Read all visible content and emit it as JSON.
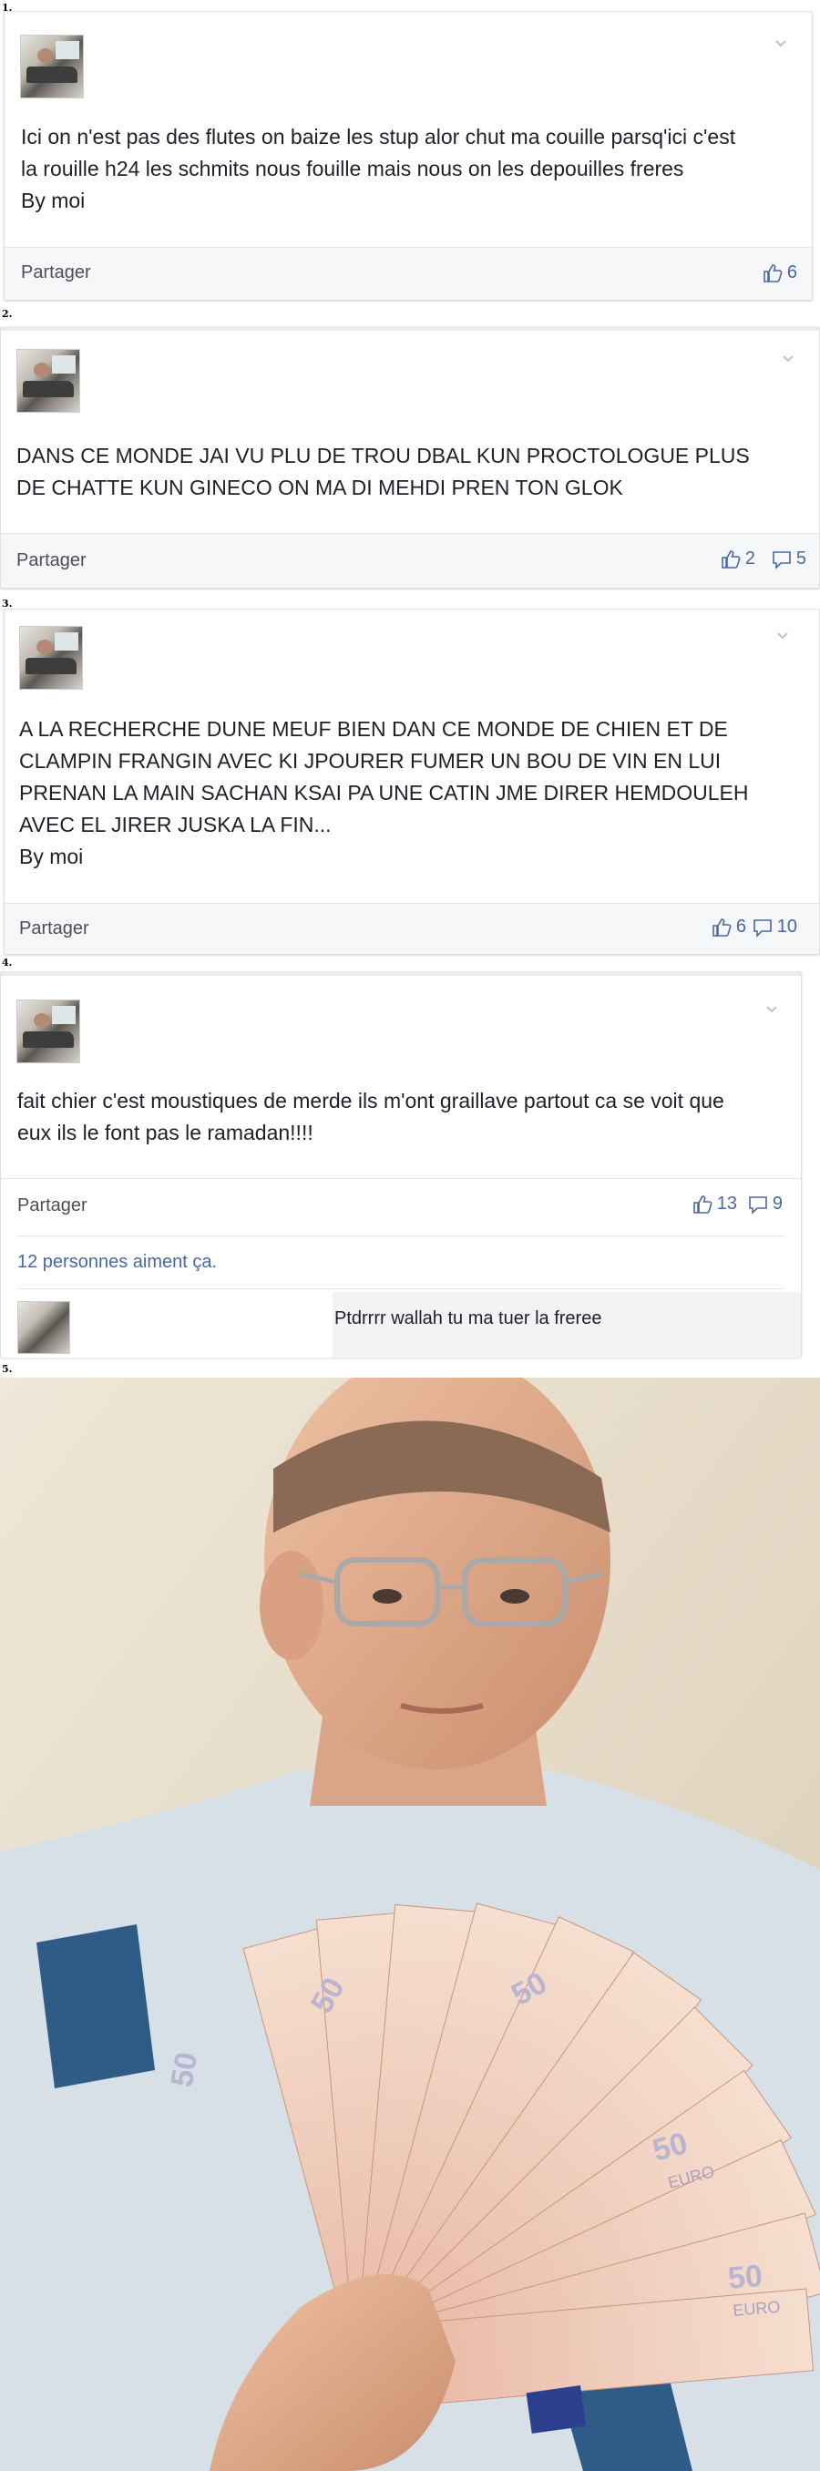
{
  "posts": [
    {
      "number": "1.",
      "text_lines": [
        "Ici on n'est pas des flutes on baize les stup alor chut ma couille parsq'ici c'est",
        "la rouille h24 les schmits nous fouille mais nous on les depouilles freres",
        "By moi"
      ],
      "share_label": "Partager",
      "likes": "6"
    },
    {
      "number": "2.",
      "text_lines": [
        "DANS CE MONDE JAI VU PLU DE TROU DBAL KUN PROCTOLOGUE PLUS",
        "DE CHATTE KUN GINECO ON MA DI MEHDI PREN TON GLOK"
      ],
      "share_label": "Partager",
      "likes": "2",
      "comments": "5"
    },
    {
      "number": "3.",
      "text_lines": [
        "A LA RECHERCHE DUNE MEUF BIEN DAN CE MONDE DE CHIEN ET DE",
        "CLAMPIN FRANGIN AVEC KI JPOURER FUMER UN BOU DE VIN EN LUI",
        "PRENAN LA MAIN SACHAN KSAI PA UNE CATIN JME DIRER HEMDOULEH",
        "AVEC EL JIRER JUSKA LA FIN...",
        "By moi"
      ],
      "share_label": "Partager",
      "likes": "6",
      "comments": "10"
    },
    {
      "number": "4.",
      "text_lines": [
        "fait chier c'est moustiques de merde ils m'ont graillave partout ca se voit que",
        "eux ils le font pas le ramadan!!!!"
      ],
      "share_label": "Partager",
      "likes": "13",
      "comments": "9",
      "likes_summary_count": "12 personnes",
      "likes_summary_suffix": " aiment ça.",
      "comment_text": "Ptdrrrr wallah tu ma tuer la freree"
    }
  ],
  "photo": {
    "number": "5.",
    "banknote_value": "50",
    "banknote_word": "EURO"
  },
  "colors": {
    "link_blue": "#4b67a1",
    "footer_bg": "#f6f7f9",
    "border": "#dddfe2"
  },
  "icons": [
    "thumbs-up-icon",
    "comment-icon",
    "chevron-down-icon"
  ]
}
